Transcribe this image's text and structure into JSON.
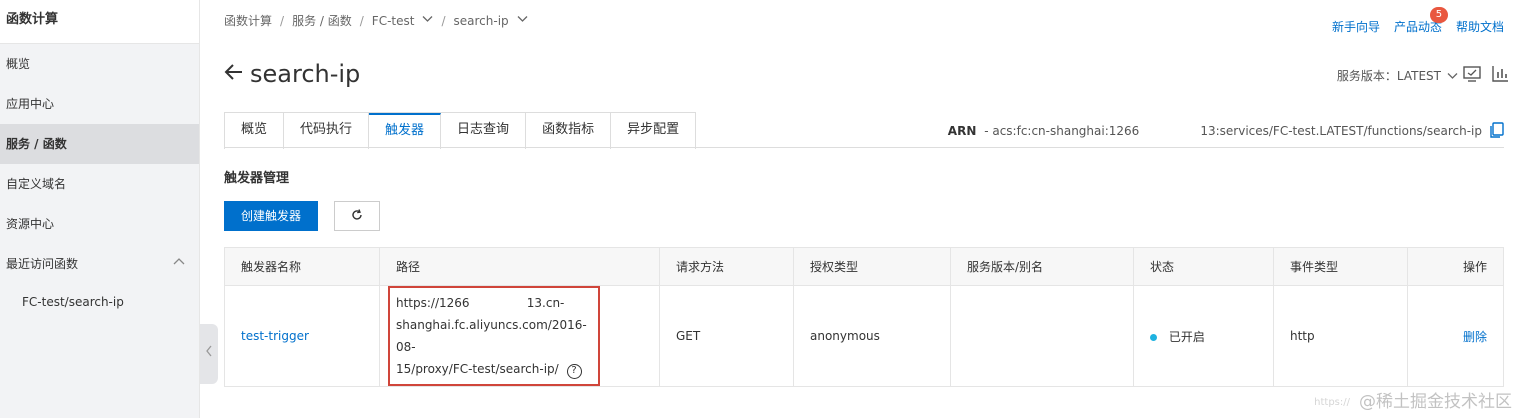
{
  "sidebar": {
    "title": "函数计算",
    "items": [
      {
        "label": "概览"
      },
      {
        "label": "应用中心"
      },
      {
        "label": "服务 / 函数"
      },
      {
        "label": "自定义域名"
      },
      {
        "label": "资源中心"
      },
      {
        "label": "最近访问函数"
      }
    ],
    "recent": [
      {
        "label": "FC-test/search-ip"
      }
    ]
  },
  "breadcrumb": {
    "items": [
      "函数计算",
      "服务 / 函数",
      "FC-test",
      "search-ip"
    ]
  },
  "toplinks": {
    "guide": "新手向导",
    "news": "产品动态",
    "news_badge": "5",
    "help": "帮助文档"
  },
  "page": {
    "title": "search-ip",
    "version_label": "服务版本：LATEST"
  },
  "tabs": [
    "概览",
    "代码执行",
    "触发器",
    "日志查询",
    "函数指标",
    "异步配置"
  ],
  "arn": {
    "label": "ARN",
    "value": "- acs:fc:cn-shanghai:1266                13:services/FC-test.LATEST/functions/search-ip"
  },
  "section": {
    "title": "触发器管理",
    "create_button": "创建触发器"
  },
  "table": {
    "headers": [
      "触发器名称",
      "路径",
      "请求方法",
      "授权类型",
      "服务版本/别名",
      "状态",
      "事件类型",
      "操作"
    ],
    "row": {
      "name": "test-trigger",
      "path_line1": "https://1266               13.cn-",
      "path_line2": "shanghai.fc.aliyuncs.com/2016-08-",
      "path_line3": "15/proxy/FC-test/search-ip/",
      "method": "GET",
      "auth": "anonymous",
      "version": "",
      "status": "已开启",
      "event_type": "http",
      "action": "删除"
    }
  },
  "watermark": "@稀土掘金技术社区",
  "watermark_small": "https://"
}
